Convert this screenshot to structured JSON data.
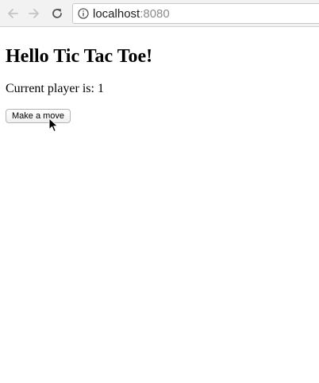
{
  "browser": {
    "url_host": "localhost",
    "url_port": ":8080",
    "back_icon": "arrow-left-icon",
    "forward_icon": "arrow-right-icon",
    "reload_icon": "reload-icon",
    "info_icon": "info-icon"
  },
  "page": {
    "title": "Hello Tic Tac Toe!",
    "player_label": "Current player is: 1",
    "move_button_label": "Make a move"
  }
}
